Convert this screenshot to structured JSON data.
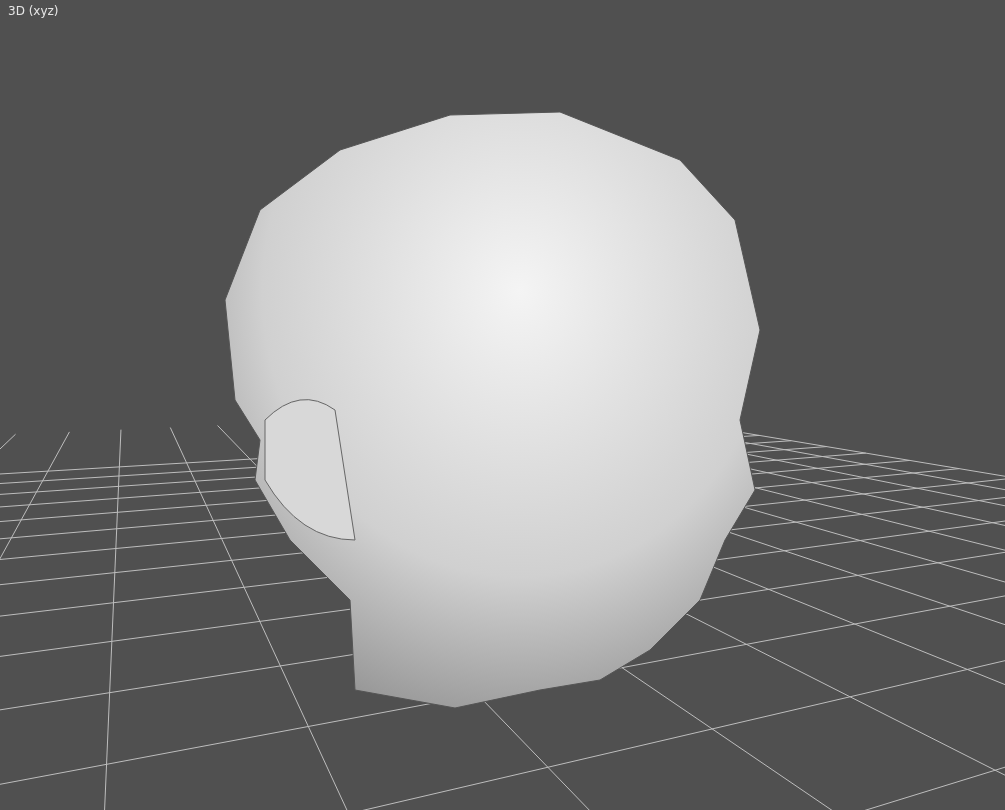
{
  "viewport": {
    "label": "3D (xyz)"
  }
}
